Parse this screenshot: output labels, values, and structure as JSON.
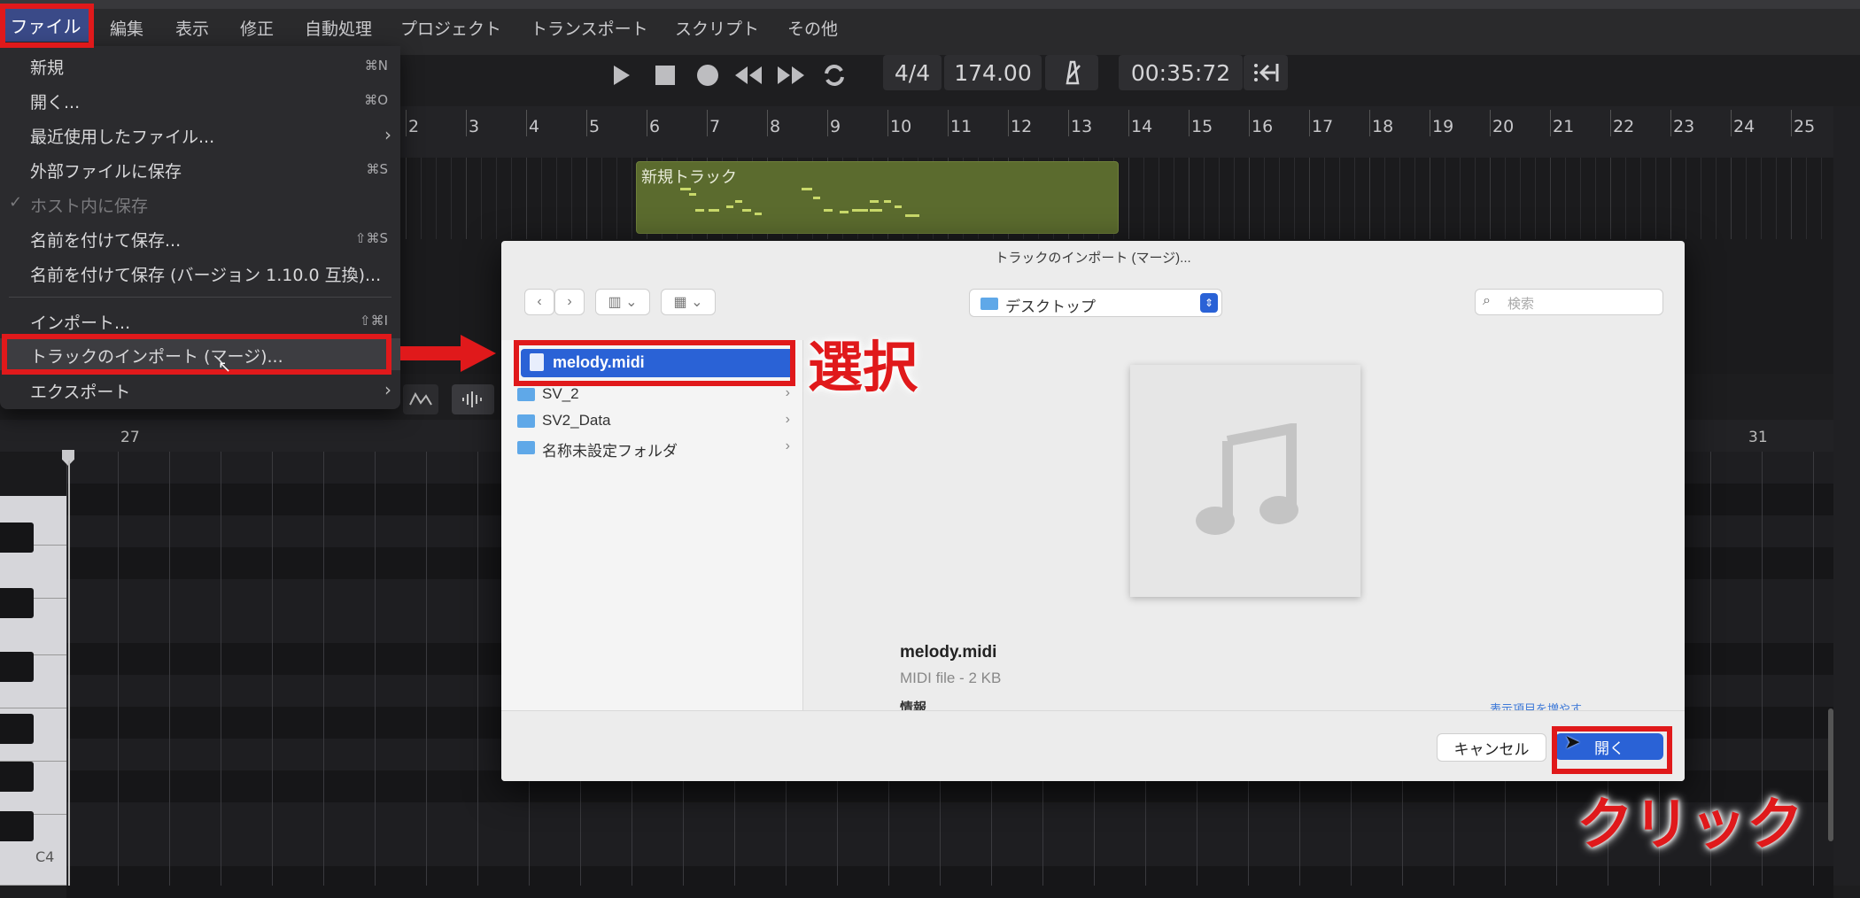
{
  "menubar": {
    "items": [
      "ファイル",
      "編集",
      "表示",
      "修正",
      "自動処理",
      "プロジェクト",
      "トランスポート",
      "スクリプト",
      "その他"
    ]
  },
  "transport": {
    "icons": [
      "play-icon",
      "stop-icon",
      "record-icon",
      "rewind-icon",
      "fast-forward-icon",
      "loop-icon"
    ],
    "time_signature": "4/4",
    "tempo": "174.00",
    "position": "00:35:72"
  },
  "ruler": {
    "bars": [
      "2",
      "3",
      "4",
      "5",
      "6",
      "7",
      "8",
      "9",
      "10",
      "11",
      "12",
      "13",
      "14",
      "15",
      "16",
      "17",
      "18",
      "19",
      "20",
      "21",
      "22",
      "23",
      "24",
      "25"
    ]
  },
  "track": {
    "clip_label": "新規トラック"
  },
  "pianoroll": {
    "ruler_left": "27",
    "ruler_right": "31",
    "key_label": "C4"
  },
  "file_menu": {
    "items": [
      {
        "label": "新規",
        "shortcut": "⌘N"
      },
      {
        "label": "開く...",
        "shortcut": "⌘O"
      },
      {
        "label": "最近使用したファイル...",
        "shortcut": ""
      },
      {
        "label": "外部ファイルに保存",
        "shortcut": "⌘S"
      },
      {
        "label": "ホスト内に保存",
        "shortcut": ""
      },
      {
        "label": "名前を付けて保存...",
        "shortcut": "⇧⌘S"
      },
      {
        "label": "名前を付けて保存 (バージョン 1.10.0 互換)...",
        "shortcut": ""
      },
      {
        "label": "インポート...",
        "shortcut": "⇧⌘I"
      },
      {
        "label": "トラックのインポート (マージ)...",
        "shortcut": ""
      },
      {
        "label": "エクスポート",
        "shortcut": ""
      }
    ],
    "checkmark": "✓"
  },
  "dialog": {
    "title": "トラックのインポート (マージ)...",
    "location": "デスクトップ",
    "search_placeholder": "検索",
    "files": [
      "melody.midi",
      "SV_2",
      "SV2_Data",
      "名称未設定フォルダ"
    ],
    "preview_name": "melody.midi",
    "preview_meta": "MIDI file - 2 KB",
    "preview_info": "情報",
    "show_more": "表示項目を増やす",
    "cancel": "キャンセル",
    "open": "開く"
  },
  "annotations": {
    "select": "選択",
    "click": "クリック"
  },
  "colors": {
    "highlight": "#e0191b",
    "selection": "#2a62d6",
    "clip": "#5b6b2e"
  }
}
